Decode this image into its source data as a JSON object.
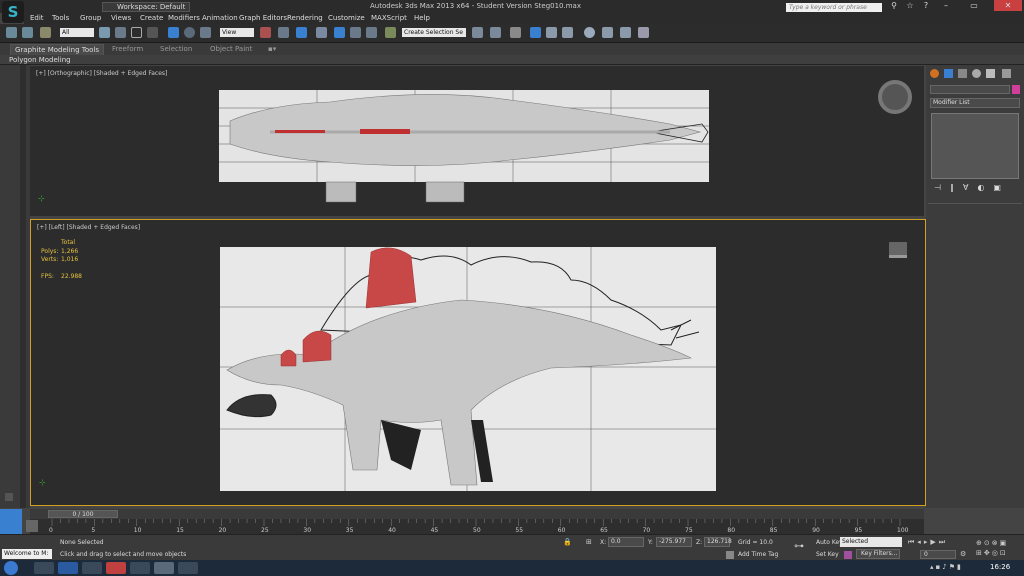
{
  "app": {
    "logo": "S",
    "workspace": "Workspace: Default",
    "title": "Autodesk 3ds Max  2013 x64  -  Student Version    Steg010.max",
    "search_placeholder": "Type a keyword or phrase"
  },
  "menu": [
    "Edit",
    "Tools",
    "Group",
    "Views",
    "Create",
    "Modifiers",
    "Animation",
    "Graph Editors",
    "Rendering",
    "Customize",
    "MAXScript",
    "Help"
  ],
  "toolbar": {
    "filter": "All",
    "view": "View",
    "selection_set": "Create Selection Se"
  },
  "ribbon": {
    "tabs": [
      "Graphite Modeling Tools",
      "Freeform",
      "Selection",
      "Object Paint"
    ],
    "panel": "Polygon Modeling"
  },
  "viewport_top": {
    "label": "[+] [Orthographic] [Shaded + Edged Faces]"
  },
  "viewport_left": {
    "label": "[+] [Left] [Shaded + Edged Faces]",
    "stats": {
      "header": "Total",
      "polys_label": "Polys:",
      "polys": "1,266",
      "verts_label": "Verts:",
      "verts": "1,016",
      "fps_label": "FPS:",
      "fps": "22.988"
    }
  },
  "command_panel": {
    "modifier_list": "Modifier List",
    "accent_color": "#d0409a"
  },
  "timeline": {
    "slider": "0 / 100",
    "ticks": [
      "0",
      "5",
      "10",
      "15",
      "20",
      "25",
      "30",
      "35",
      "40",
      "45",
      "50",
      "55",
      "60",
      "65",
      "70",
      "75",
      "80",
      "85",
      "90",
      "95",
      "100"
    ]
  },
  "status": {
    "selection": "None Selected",
    "prompt": "Click and drag to select and move objects",
    "welcome": "Welcome to M:",
    "x_label": "X:",
    "x": "0.0",
    "y_label": "Y:",
    "y": "-275.977",
    "z_label": "Z:",
    "z": "126.718",
    "grid": "Grid = 10.0",
    "add_time_tag": "Add Time Tag",
    "auto_key": "Auto Key",
    "auto_key_mode": "Selected",
    "set_key": "Set Key",
    "key_filters": "Key Filters...",
    "frame": "0"
  },
  "taskbar": {
    "clock": "16:26"
  },
  "colors": {
    "highlight": "#d85050",
    "viewport_bg": "#2c2c2c",
    "active_border": "#d4a020",
    "stats": "#e8c340"
  }
}
